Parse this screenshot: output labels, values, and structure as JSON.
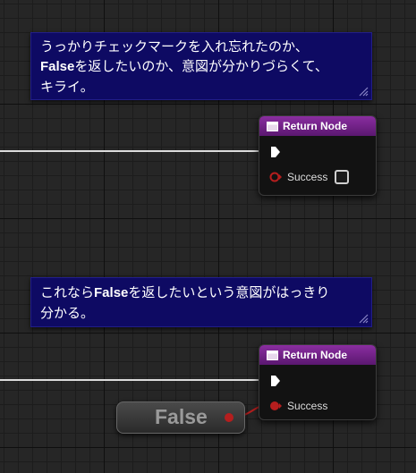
{
  "comments": [
    {
      "line1": "うっかりチェックマークを入れ忘れたのか、",
      "line2_bold": "False",
      "line2_rest": "を返したいのか、意図が分かりづらくて、",
      "line3": "キライ。"
    },
    {
      "line1_pre": "これなら",
      "line1_bold": "False",
      "line1_post": "を返したいという意図がはっきり",
      "line2": "分かる。"
    }
  ],
  "nodes": [
    {
      "title": "Return Node",
      "pin_label": "Success"
    },
    {
      "title": "Return Node",
      "pin_label": "Success"
    }
  ],
  "literal": {
    "label": "False"
  },
  "colors": {
    "comment_bg": "#0e0a63",
    "header": "#8a2ea0",
    "bool_pin": "#b51e1e",
    "wire": "#dcdcdc"
  }
}
